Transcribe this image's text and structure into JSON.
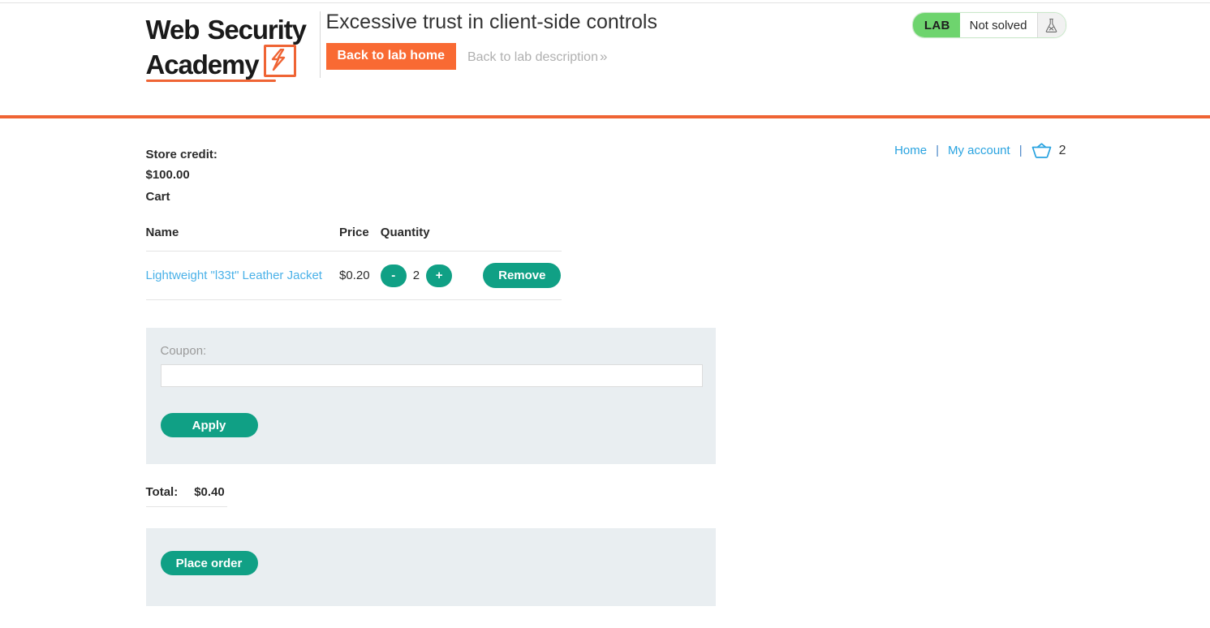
{
  "header": {
    "logo": {
      "line1_a": "Web",
      "line1_b": "Security",
      "line2": "Academy",
      "bolt_icon": "lightning-bolt-icon"
    },
    "lab_title": "Excessive trust in client-side controls",
    "back_to_lab_home": "Back to lab home",
    "back_to_lab_description": "Back to lab description",
    "back_to_lab_description_chevron": "»",
    "status": {
      "tag": "LAB",
      "state": "Not solved",
      "flask_icon": "flask-not-solved-icon"
    },
    "colors": {
      "orange": "#ef6434",
      "button_orange": "#f96a33",
      "lab_green": "#6ed46e"
    }
  },
  "shop_nav": {
    "home": "Home",
    "my_account": "My account",
    "separator": "|",
    "basket_icon": "basket-icon",
    "basket_count": "2",
    "link_color": "#29a3e0"
  },
  "cart": {
    "store_credit_label": "Store credit:",
    "store_credit_value": "$100.00",
    "heading": "Cart",
    "columns": [
      "Name",
      "Price",
      "Quantity"
    ],
    "items": [
      {
        "name": "Lightweight \"l33t\" Leather Jacket",
        "price": "$0.20",
        "decrement_label": "-",
        "quantity": "2",
        "increment_label": "+",
        "remove_label": "Remove"
      }
    ],
    "coupon_label": "Coupon:",
    "coupon_value": "",
    "coupon_placeholder": "",
    "apply_label": "Apply",
    "total_label": "Total:",
    "total_value": "$0.40",
    "place_order_label": "Place order",
    "colors": {
      "teal": "#10a085",
      "panel": "#e9eef1",
      "item_link": "#4ab1e8"
    }
  }
}
